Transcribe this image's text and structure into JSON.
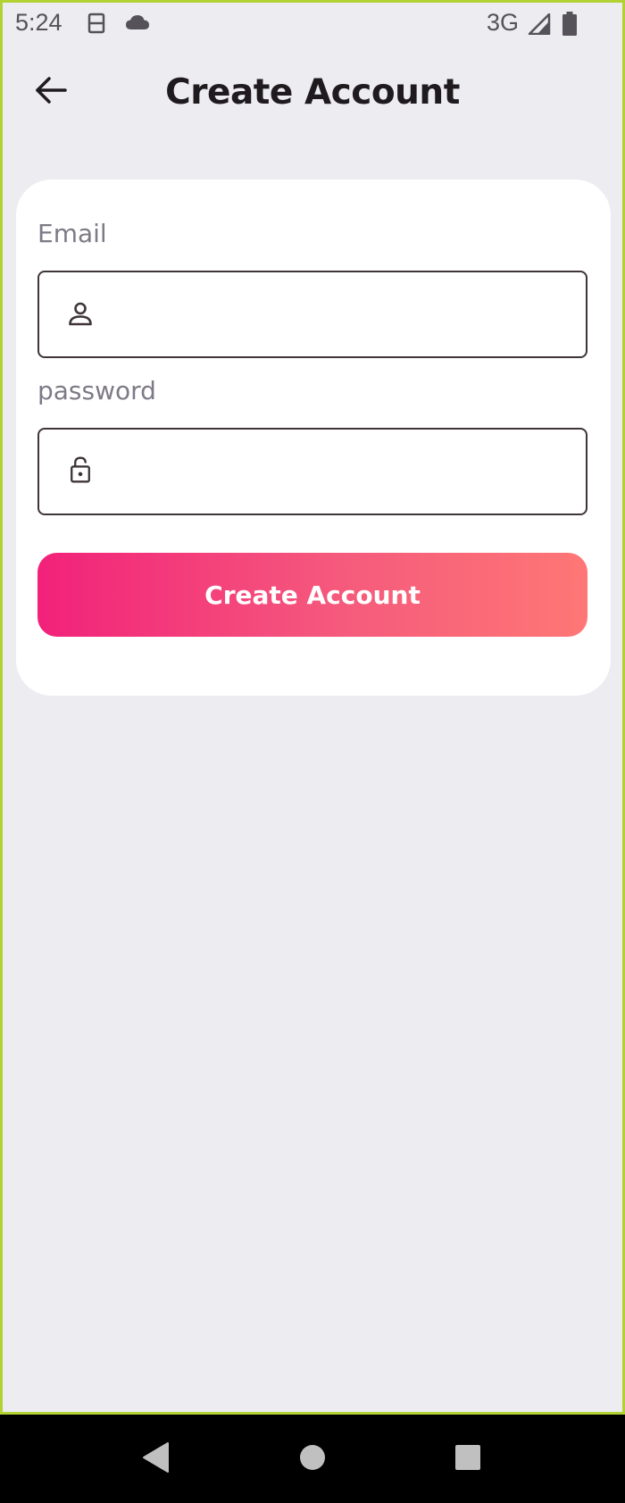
{
  "status_bar": {
    "time": "5:24",
    "network": "3G",
    "icons": [
      "sim-card-icon",
      "cloud-icon",
      "signal-icon",
      "battery-icon"
    ]
  },
  "topbar": {
    "back_icon": "arrow-left-icon",
    "title": "Create Account"
  },
  "form": {
    "email": {
      "label": "Email",
      "icon": "person-icon",
      "value": "",
      "placeholder": ""
    },
    "password": {
      "label": "password",
      "icon": "lock-icon",
      "value": "",
      "placeholder": ""
    },
    "submit_label": "Create Account"
  },
  "nav_bar": {
    "buttons": [
      "back-triangle-icon",
      "home-circle-icon",
      "recents-square-icon"
    ]
  },
  "colors": {
    "background": "#EDECF1",
    "card": "#FFFFFF",
    "accent_start": "#F2217A",
    "accent_end": "#FE7775",
    "frame": "#B2D234"
  }
}
